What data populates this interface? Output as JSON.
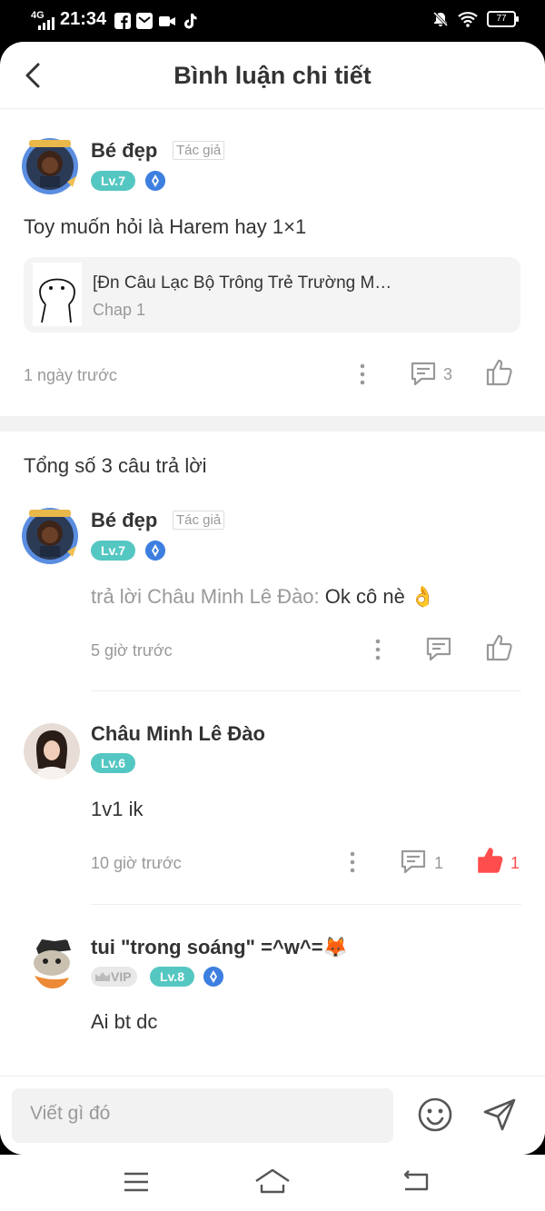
{
  "status": {
    "network": "4G",
    "time": "21:34",
    "battery": "77"
  },
  "header": {
    "title": "Bình luận chi tiết"
  },
  "main_comment": {
    "author": "Bé đẹp",
    "tag": "Tác giả",
    "level": "Lv.7",
    "text": "Toy muốn hỏi là Harem hay 1×1",
    "chapter_title": "[Đn Câu Lạc Bộ Trông Trẻ Trường M…",
    "chapter_sub": "Chap 1",
    "time": "1 ngày trước",
    "reply_count": "3"
  },
  "replies_total": "Tổng số 3 câu trả lời",
  "replies": [
    {
      "author": "Bé đẹp",
      "tag": "Tác giả",
      "level": "Lv.7",
      "prefix": "trả lời Châu Minh Lê Đào: ",
      "text": "Ok cô nè 👌",
      "time": "5 giờ trước"
    },
    {
      "author": "Châu Minh Lê Đào",
      "level": "Lv.6",
      "text": "1v1 ik",
      "time": "10 giờ trước",
      "reply_count": "1",
      "like_count": "1"
    },
    {
      "author": "tui \"trong soáng\" =^w^=🦊",
      "vip": "VIP",
      "level": "Lv.8",
      "text": "Ai bt dc"
    }
  ],
  "input": {
    "placeholder": "Viết gì đó"
  },
  "colors": {
    "level_badge": "#55c7c2",
    "liked": "#ff4d4d",
    "diamond": "#3d7fe0"
  }
}
